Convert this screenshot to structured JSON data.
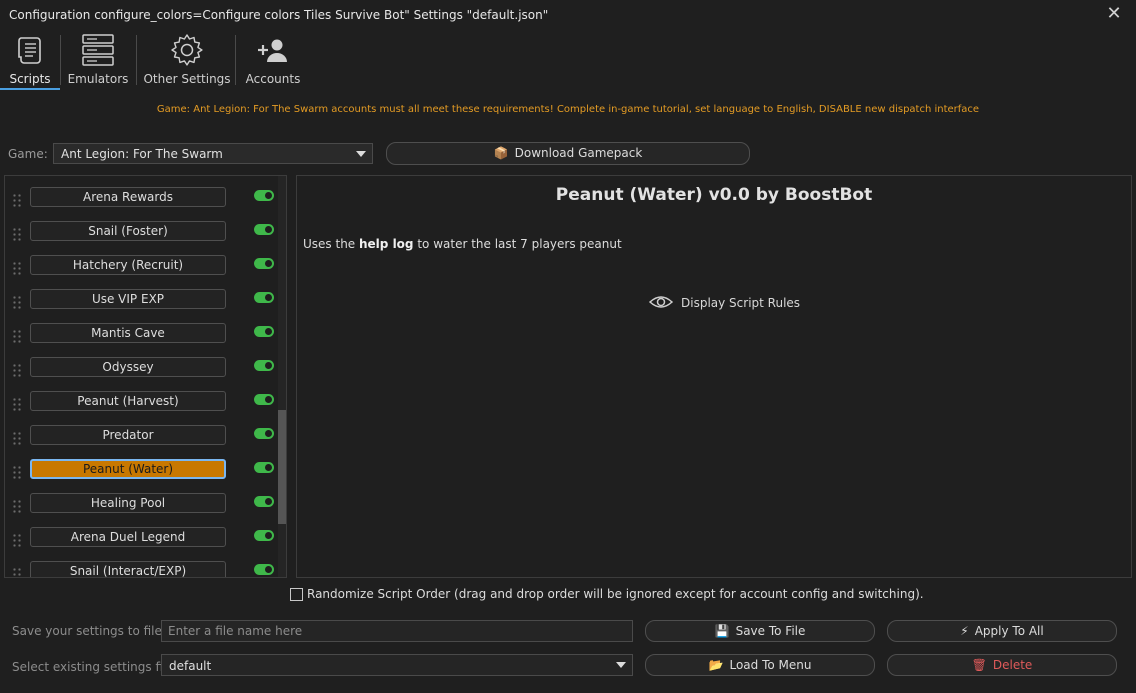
{
  "window": {
    "title": "Configuration configure_colors=Configure colors Tiles Survive Bot\" Settings \"default.json\"",
    "close_glyph": "✕"
  },
  "tabs": [
    {
      "label": "Scripts",
      "icon": "scroll-icon",
      "active": true
    },
    {
      "label": "Emulators",
      "icon": "server-icon",
      "active": false
    },
    {
      "label": "Other Settings",
      "icon": "gear-icon",
      "active": false
    },
    {
      "label": "Accounts",
      "icon": "add-user-icon",
      "active": false
    }
  ],
  "warning": "Game: Ant Legion: For The Swarm accounts must all meet these requirements! Complete in-game tutorial, set language to English, DISABLE new dispatch interface",
  "game": {
    "label": "Game:",
    "selected": "Ant Legion: For The Swarm",
    "download_button": "Download Gamepack"
  },
  "scripts": [
    {
      "name": "Arena Rewards",
      "enabled": true,
      "selected": false
    },
    {
      "name": "Snail (Foster)",
      "enabled": true,
      "selected": false
    },
    {
      "name": "Hatchery (Recruit)",
      "enabled": true,
      "selected": false
    },
    {
      "name": "Use VIP EXP",
      "enabled": true,
      "selected": false
    },
    {
      "name": "Mantis Cave",
      "enabled": true,
      "selected": false
    },
    {
      "name": "Odyssey",
      "enabled": true,
      "selected": false
    },
    {
      "name": "Peanut (Harvest)",
      "enabled": true,
      "selected": false
    },
    {
      "name": "Predator",
      "enabled": true,
      "selected": false
    },
    {
      "name": "Peanut (Water)",
      "enabled": true,
      "selected": true
    },
    {
      "name": "Healing Pool",
      "enabled": true,
      "selected": false
    },
    {
      "name": "Arena Duel Legend",
      "enabled": true,
      "selected": false
    },
    {
      "name": "Snail (Interact/EXP)",
      "enabled": true,
      "selected": false
    }
  ],
  "detail": {
    "title": "Peanut (Water) v0.0 by BoostBot",
    "desc_before": "Uses the ",
    "desc_bold": "help log",
    "desc_after": " to water the last 7 players peanut",
    "rules_button": "Display Script Rules"
  },
  "randomize": {
    "label": "Randomize Script Order (drag and drop order will be ignored except for account config and switching).",
    "checked": false
  },
  "save": {
    "label": "Save your settings to file",
    "placeholder": "Enter a file name here",
    "save_button": "Save To File",
    "apply_button": "Apply To All"
  },
  "load": {
    "label": "Select existing settings file",
    "selected": "default",
    "load_button": "Load To Menu",
    "delete_button": "Delete"
  },
  "colors": {
    "accent": "#4a9fe0",
    "selected_script": "#c87800",
    "toggle_on": "#3fb84a",
    "warning": "#e39b24",
    "danger": "#e05a5a"
  }
}
